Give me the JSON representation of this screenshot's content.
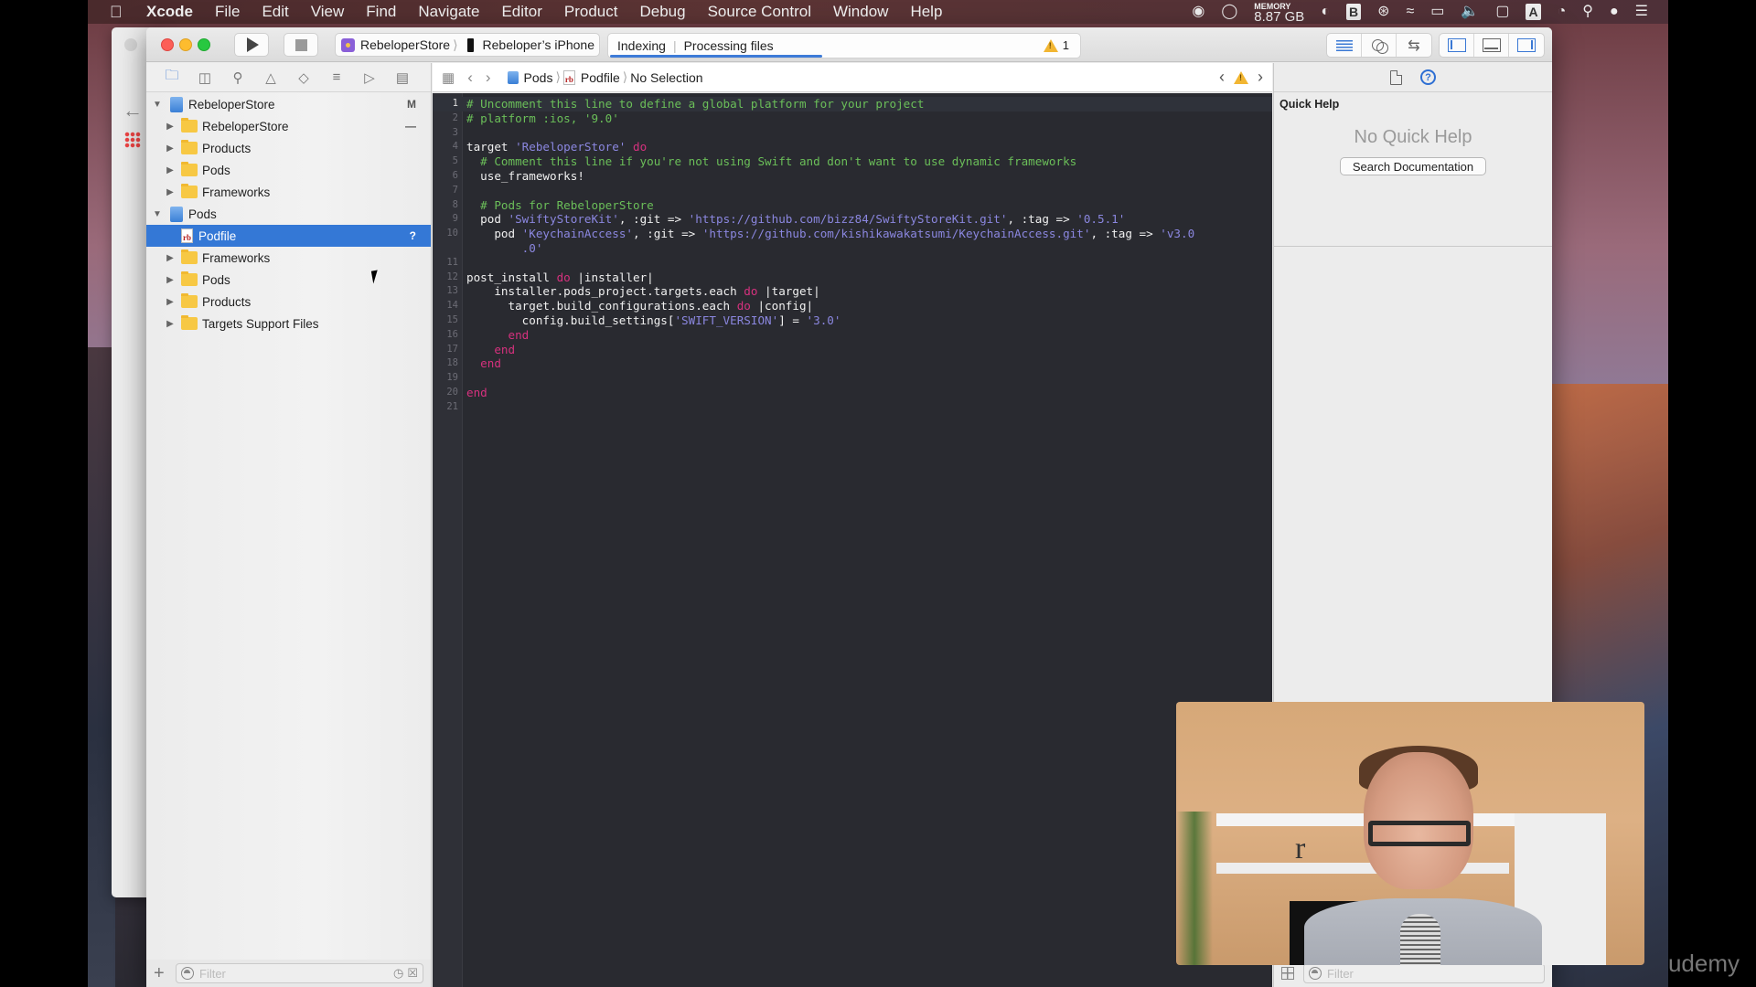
{
  "menubar": {
    "app_name": "Xcode",
    "items": [
      "File",
      "Edit",
      "View",
      "Find",
      "Navigate",
      "Editor",
      "Product",
      "Debug",
      "Source Control",
      "Window",
      "Help"
    ],
    "status": {
      "memory_label": "MEMORY",
      "memory_value": "8.87 GB",
      "icons": [
        "record-icon",
        "circle-icon",
        "memory-icon",
        "gauge-icon",
        "bartender-icon",
        "bluetooth-icon",
        "wifi-icon",
        "airplay-icon",
        "volume-icon",
        "battery-icon",
        "input-source-icon",
        "timemachine-icon",
        "spotlight-icon",
        "siri-icon",
        "notification-center-icon"
      ],
      "input_source": "A"
    }
  },
  "toolbar": {
    "scheme": "RebeloperStore",
    "destination": "Rebeloper’s iPhone",
    "activity_task": "Indexing",
    "activity_status": "Processing files",
    "activity_progress_percent": 45,
    "warning_count": "1"
  },
  "navigator": {
    "tabs": [
      "project-navigator",
      "symbol-navigator",
      "find-navigator",
      "issue-navigator",
      "test-navigator",
      "debug-navigator",
      "breakpoint-navigator",
      "report-navigator"
    ],
    "tree": [
      {
        "label": "RebeloperStore",
        "type": "project",
        "level": 0,
        "expanded": true,
        "badge": "M"
      },
      {
        "label": "RebeloperStore",
        "type": "folder",
        "level": 1,
        "expanded": false,
        "badge": "—"
      },
      {
        "label": "Products",
        "type": "folder",
        "level": 1,
        "expanded": false,
        "badge": ""
      },
      {
        "label": "Pods",
        "type": "folder",
        "level": 1,
        "expanded": false,
        "badge": ""
      },
      {
        "label": "Frameworks",
        "type": "folder",
        "level": 1,
        "expanded": false,
        "badge": ""
      },
      {
        "label": "Pods",
        "type": "project",
        "level": 0,
        "expanded": true,
        "badge": ""
      },
      {
        "label": "Podfile",
        "type": "ruby-file",
        "level": 1,
        "selected": true,
        "badge": "?"
      },
      {
        "label": "Frameworks",
        "type": "folder",
        "level": 1,
        "expanded": false,
        "badge": ""
      },
      {
        "label": "Pods",
        "type": "folder",
        "level": 1,
        "expanded": false,
        "badge": ""
      },
      {
        "label": "Products",
        "type": "folder",
        "level": 1,
        "expanded": false,
        "badge": ""
      },
      {
        "label": "Targets Support Files",
        "type": "folder",
        "level": 1,
        "expanded": false,
        "badge": ""
      }
    ],
    "filter_placeholder": "Filter"
  },
  "jumpbar": {
    "crumbs": [
      "Pods",
      "Podfile",
      "No Selection"
    ],
    "rb_glyph": "rb"
  },
  "editor": {
    "current_line": 1,
    "lines": [
      [
        [
          "c-com",
          "# Uncomment this line to define a global platform for your project"
        ]
      ],
      [
        [
          "c-com",
          "# platform :ios, '9.0'"
        ]
      ],
      [],
      [
        [
          "",
          "target "
        ],
        [
          "c-str",
          "'RebeloperStore'"
        ],
        [
          "",
          " "
        ],
        [
          "c-kw",
          "do"
        ]
      ],
      [
        [
          "",
          "  "
        ],
        [
          "c-com",
          "# Comment this line if you're not using Swift and don't want to use dynamic frameworks"
        ]
      ],
      [
        [
          "",
          "  use_frameworks!"
        ]
      ],
      [],
      [
        [
          "",
          "  "
        ],
        [
          "c-com",
          "# Pods for RebeloperStore"
        ]
      ],
      [
        [
          "",
          "  pod "
        ],
        [
          "c-str",
          "'SwiftyStoreKit'"
        ],
        [
          "",
          ", :git => "
        ],
        [
          "c-str",
          "'https://github.com/bizz84/SwiftyStoreKit.git'"
        ],
        [
          "",
          ", :tag => "
        ],
        [
          "c-str",
          "'0.5.1'"
        ]
      ],
      [
        [
          "",
          "    pod "
        ],
        [
          "c-str",
          "'KeychainAccess'"
        ],
        [
          "",
          ", :git => "
        ],
        [
          "c-str",
          "'https://github.com/kishikawakatsumi/KeychainAccess.git'"
        ],
        [
          "",
          ", :tag => "
        ],
        [
          "c-str",
          "'v3.0"
        ]
      ],
      [
        [
          "",
          "        "
        ],
        [
          "c-str",
          ".0'"
        ]
      ],
      [],
      [
        [
          "",
          "post_install "
        ],
        [
          "c-kw",
          "do"
        ],
        [
          "",
          " |installer|"
        ]
      ],
      [
        [
          "",
          "    installer.pods_project.targets.each "
        ],
        [
          "c-kw",
          "do"
        ],
        [
          "",
          " |target|"
        ]
      ],
      [
        [
          "",
          "      target.build_configurations.each "
        ],
        [
          "c-kw",
          "do"
        ],
        [
          "",
          " |config|"
        ]
      ],
      [
        [
          "",
          "        config.build_settings["
        ],
        [
          "c-str",
          "'SWIFT_VERSION'"
        ],
        [
          "",
          "] = "
        ],
        [
          "c-str",
          "'3.0'"
        ]
      ],
      [
        [
          "",
          "      "
        ],
        [
          "c-kw",
          "end"
        ]
      ],
      [
        [
          "",
          "    "
        ],
        [
          "c-kw",
          "end"
        ]
      ],
      [
        [
          "",
          "  "
        ],
        [
          "c-kw",
          "end"
        ]
      ],
      [],
      [
        [
          "c-kw",
          "end"
        ]
      ],
      []
    ],
    "line_numbers": [
      "1",
      "2",
      "3",
      "4",
      "5",
      "6",
      "7",
      "8",
      "9",
      "10",
      "",
      "11",
      "12",
      "13",
      "14",
      "15",
      "16",
      "17",
      "18",
      "19",
      "20",
      "21"
    ]
  },
  "inspector": {
    "title": "Quick Help",
    "empty_message": "No Quick Help",
    "search_button": "Search Documentation",
    "help_glyph": "?",
    "filter_placeholder": "Filter"
  },
  "overlay": {
    "watermark": "udemy",
    "webcam_letter": "r"
  }
}
